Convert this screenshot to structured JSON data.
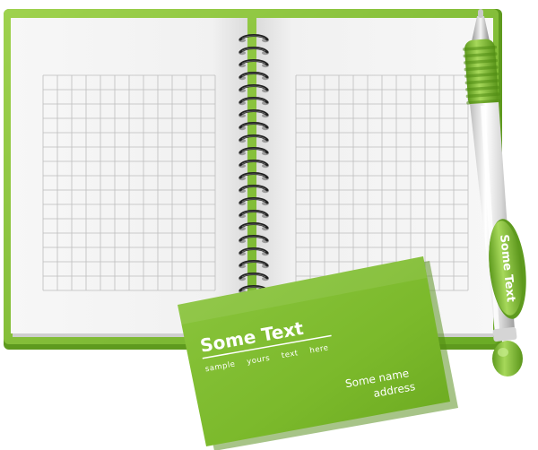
{
  "card": {
    "title": "Some Text",
    "tagline_words": [
      "sample",
      "yours",
      "text",
      "here"
    ],
    "name": "Some name",
    "address": "address"
  },
  "pen": {
    "label": "Some Text"
  },
  "colors": {
    "cover_green": "#8cc63f",
    "cover_dark": "#5e9a1e",
    "card_green": "#7dbb2e",
    "page": "#f2f2f2",
    "grid_line": "#bdbdbd",
    "spiral": "#222222"
  }
}
